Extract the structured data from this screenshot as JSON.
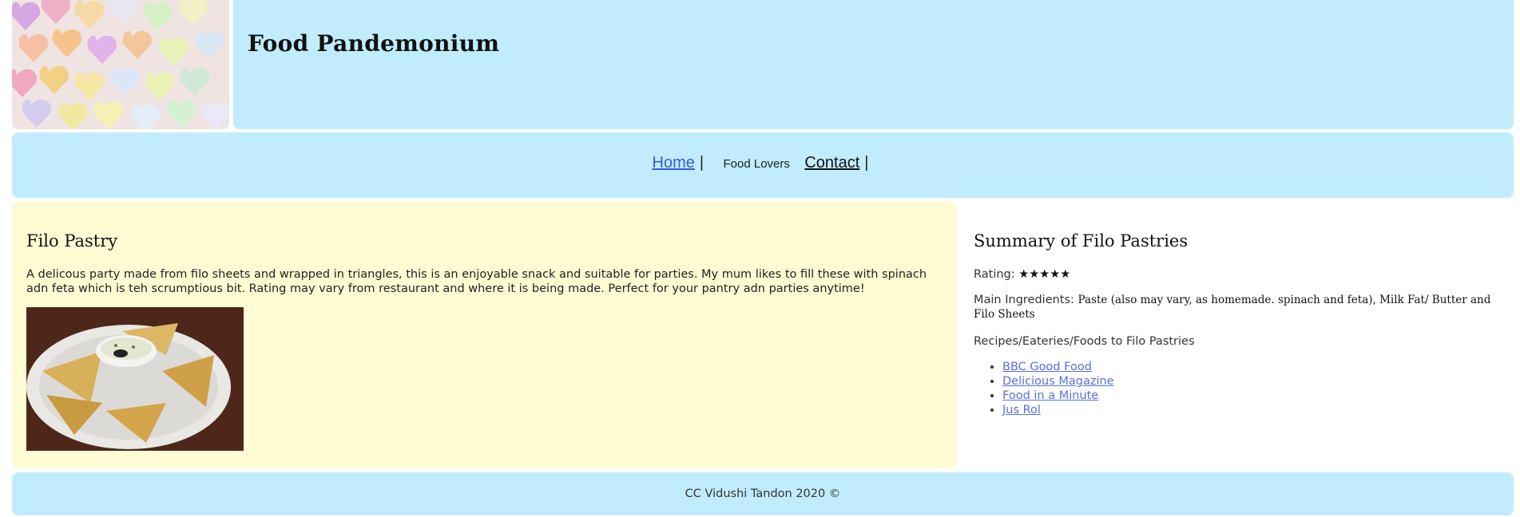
{
  "header": {
    "title": "Food Pandemonium"
  },
  "nav": {
    "items": [
      {
        "label": "Home"
      },
      {
        "label": "Food Lovers"
      },
      {
        "label": "Contact"
      }
    ],
    "separator": "|"
  },
  "main": {
    "heading": "Filo Pastry",
    "description": "A delicous party made from filo sheets and wrapped in triangles, this is an enjoyable snack and suitable for parties. My mum likes to fill these with spinach adn feta which is teh scrumptious bit. Rating may vary from restaurant and where it is being made. Perfect for your pantry adn parties anytime!"
  },
  "aside": {
    "heading": "Summary of Filo Pastries",
    "rating_label": "Rating:",
    "rating_stars": "★★★★★",
    "rating_value": 5,
    "ingredients_label": "Main Ingredients:",
    "ingredients_value": "Paste (also may vary, as homemade. spinach and feta), Milk Fat/ Butter and Filo Sheets",
    "recipes_label": "Recipes/Eateries/Foods to Filo Pastries",
    "links": [
      {
        "label": "BBC Good Food"
      },
      {
        "label": "Delicious Magazine"
      },
      {
        "label": "Food in a Minute"
      },
      {
        "label": "Jus Rol"
      }
    ]
  },
  "footer": {
    "text": "CC Vidushi Tandon 2020 ©"
  },
  "colors": {
    "header_bg": "#c1ecfe",
    "main_bg": "#fffcd3",
    "link": "#5a6fe0"
  }
}
